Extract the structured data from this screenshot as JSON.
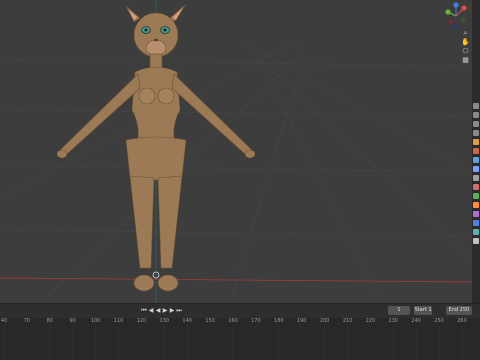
{
  "viewport": {
    "subject": "3D model of an anthropomorphic cat character in A-pose",
    "grid_color": "#4a4a4a",
    "x_axis_color": "#b04040"
  },
  "navigation": {
    "gizmo_axes": [
      {
        "name": "x-axis-icon",
        "color": "#e14b4b"
      },
      {
        "name": "y-axis-icon",
        "color": "#6fb33c"
      },
      {
        "name": "z-axis-icon",
        "color": "#3f7ee8"
      }
    ],
    "buttons": [
      {
        "name": "zoom-icon",
        "glyph": "⌕"
      },
      {
        "name": "pan-icon",
        "glyph": "✋"
      },
      {
        "name": "camera-view-icon",
        "glyph": "⎔"
      },
      {
        "name": "perspective-toggle-icon",
        "glyph": "▦"
      }
    ]
  },
  "properties_strip": {
    "tab_colors": [
      "#8a8a8a",
      "#8a8a8a",
      "#8a8a8a",
      "#8a8a8a",
      "#e0a040",
      "#c86a4a",
      "#5da2d9",
      "#7fa0ff",
      "#a0a0a0",
      "#d07070",
      "#5ab05a",
      "#ff9040",
      "#b070d0",
      "#5080e0",
      "#60b0b0",
      "#c0c0c0"
    ]
  },
  "timeline": {
    "current_frame": "1",
    "start_label": "Start",
    "start_value": "1",
    "end_label": "End",
    "end_value": "250",
    "playback_glyphs": [
      "⏮",
      "◀",
      "◀",
      "▶",
      "▶",
      "⏭"
    ],
    "ruler_ticks": [
      "40",
      "70",
      "80",
      "90",
      "100",
      "110",
      "120",
      "130",
      "140",
      "150",
      "160",
      "170",
      "180",
      "190",
      "200",
      "210",
      "220",
      "230",
      "240",
      "250",
      "260"
    ]
  }
}
